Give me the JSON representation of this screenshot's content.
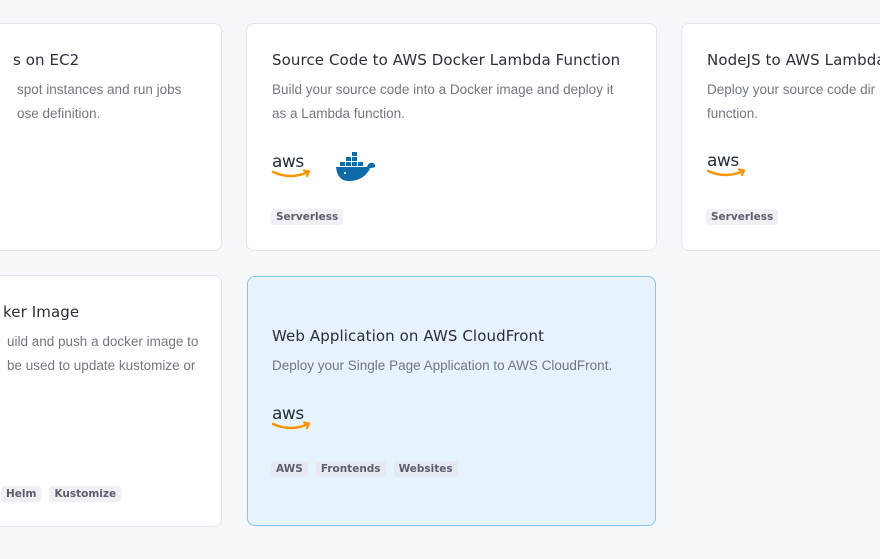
{
  "cards": [
    {
      "title": "s on EC2",
      "desc_line1": "spot instances and run jobs",
      "desc_line2": "ose definition."
    },
    {
      "title": "Source Code to AWS Docker Lambda Function",
      "desc_line1": "Build your source code into a Docker image and deploy it",
      "desc_line2": "as a Lambda function.",
      "logos": [
        "aws-logo",
        "docker-logo"
      ],
      "tags": [
        "Serverless"
      ]
    },
    {
      "title": "NodeJS to AWS Lambda",
      "desc_line1": "Deploy your source code dir",
      "desc_line2": "function.",
      "logos": [
        "aws-logo"
      ],
      "tags": [
        "Serverless"
      ]
    },
    {
      "title": "ker Image",
      "desc_line1": "uild and push a docker image to",
      "desc_line2": "be used to update kustomize or",
      "tags": [
        "Helm",
        "Kustomize"
      ]
    },
    {
      "title": "Web Application on AWS CloudFront",
      "desc_line1": "Deploy your Single Page Application to AWS CloudFront.",
      "logos": [
        "aws-logo"
      ],
      "tags": [
        "AWS",
        "Frontends",
        "Websites"
      ],
      "highlighted": true
    }
  ],
  "colors": {
    "aws_text": "#232f3e",
    "aws_smile": "#f79400",
    "docker_blue": "#1d63ed",
    "highlight_bg": "#e6f2fd",
    "highlight_border": "#8cc3e8"
  }
}
